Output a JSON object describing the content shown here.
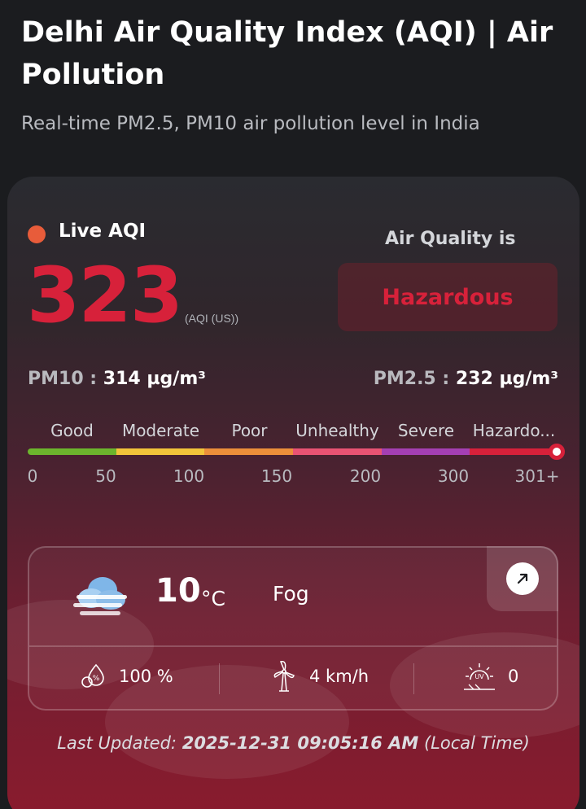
{
  "page": {
    "title": "Delhi Air Quality Index (AQI) | Air Pollution",
    "subtitle": "Real-time PM2.5, PM10 air pollution level in India"
  },
  "aqi": {
    "live_label": "Live AQI",
    "value": "323",
    "unit": "(AQI (US))",
    "quality_heading": "Air Quality is",
    "quality_status": "Hazardous",
    "colors": {
      "live_dot": "#e85c3a",
      "status": "#d7213a"
    }
  },
  "pollutants": {
    "pm10_label": "PM10 :",
    "pm10_value": "314 µg/m³",
    "pm25_label": "PM2.5 :",
    "pm25_value": "232 µg/m³"
  },
  "scale": {
    "categories": [
      {
        "label": "Good",
        "color": "#6cb52d"
      },
      {
        "label": "Moderate",
        "color": "#f2c43a"
      },
      {
        "label": "Poor",
        "color": "#ec8f3a"
      },
      {
        "label": "Unhealthy",
        "color": "#e95373"
      },
      {
        "label": "Severe",
        "color": "#a43fb3"
      },
      {
        "label": "Hazardo...",
        "color": "#d7213a"
      }
    ],
    "ticks": [
      "0",
      "50",
      "100",
      "150",
      "200",
      "300",
      "301+"
    ]
  },
  "weather": {
    "temperature": "10",
    "temperature_unit": "°C",
    "condition": "Fog",
    "humidity": "100 %",
    "wind": "4 km/h",
    "uv_index": "0",
    "icons": {
      "condition": "fog-cloud-icon",
      "humidity": "humidity-icon",
      "wind": "wind-turbine-icon",
      "uv": "uv-index-icon",
      "expand": "arrow-up-right-icon"
    }
  },
  "footer": {
    "last_updated_label": "Last Updated:",
    "last_updated_value": "2025-12-31 09:05:16 AM",
    "timezone_note": "(Local Time)"
  }
}
